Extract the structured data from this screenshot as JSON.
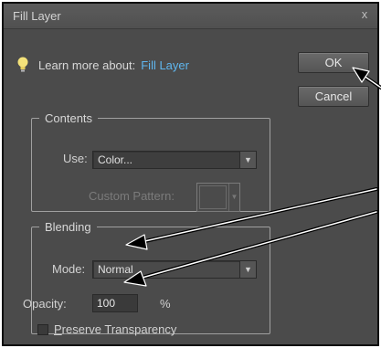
{
  "dialog": {
    "title": "Fill Layer",
    "close_glyph": "x"
  },
  "learn": {
    "prefix": "Learn more about:",
    "link": "Fill Layer",
    "icon": "lightbulb-icon"
  },
  "buttons": {
    "ok": "OK",
    "cancel": "Cancel"
  },
  "contents": {
    "legend": "Contents",
    "use_label": "Use:",
    "use_value": "Color...",
    "custom_pattern_label": "Custom Pattern:"
  },
  "blending": {
    "legend": "Blending",
    "mode_label": "Mode:",
    "mode_value": "Normal",
    "opacity_label": "Opacity:",
    "opacity_value": "100",
    "opacity_unit": "%",
    "preserve_first_letter": "P",
    "preserve_rest": "reserve Transparency",
    "preserve_checked": false
  },
  "colors": {
    "dialog_bg": "#4b4b4b",
    "link": "#5fb6ee",
    "annotation_arrow": "#000000"
  }
}
